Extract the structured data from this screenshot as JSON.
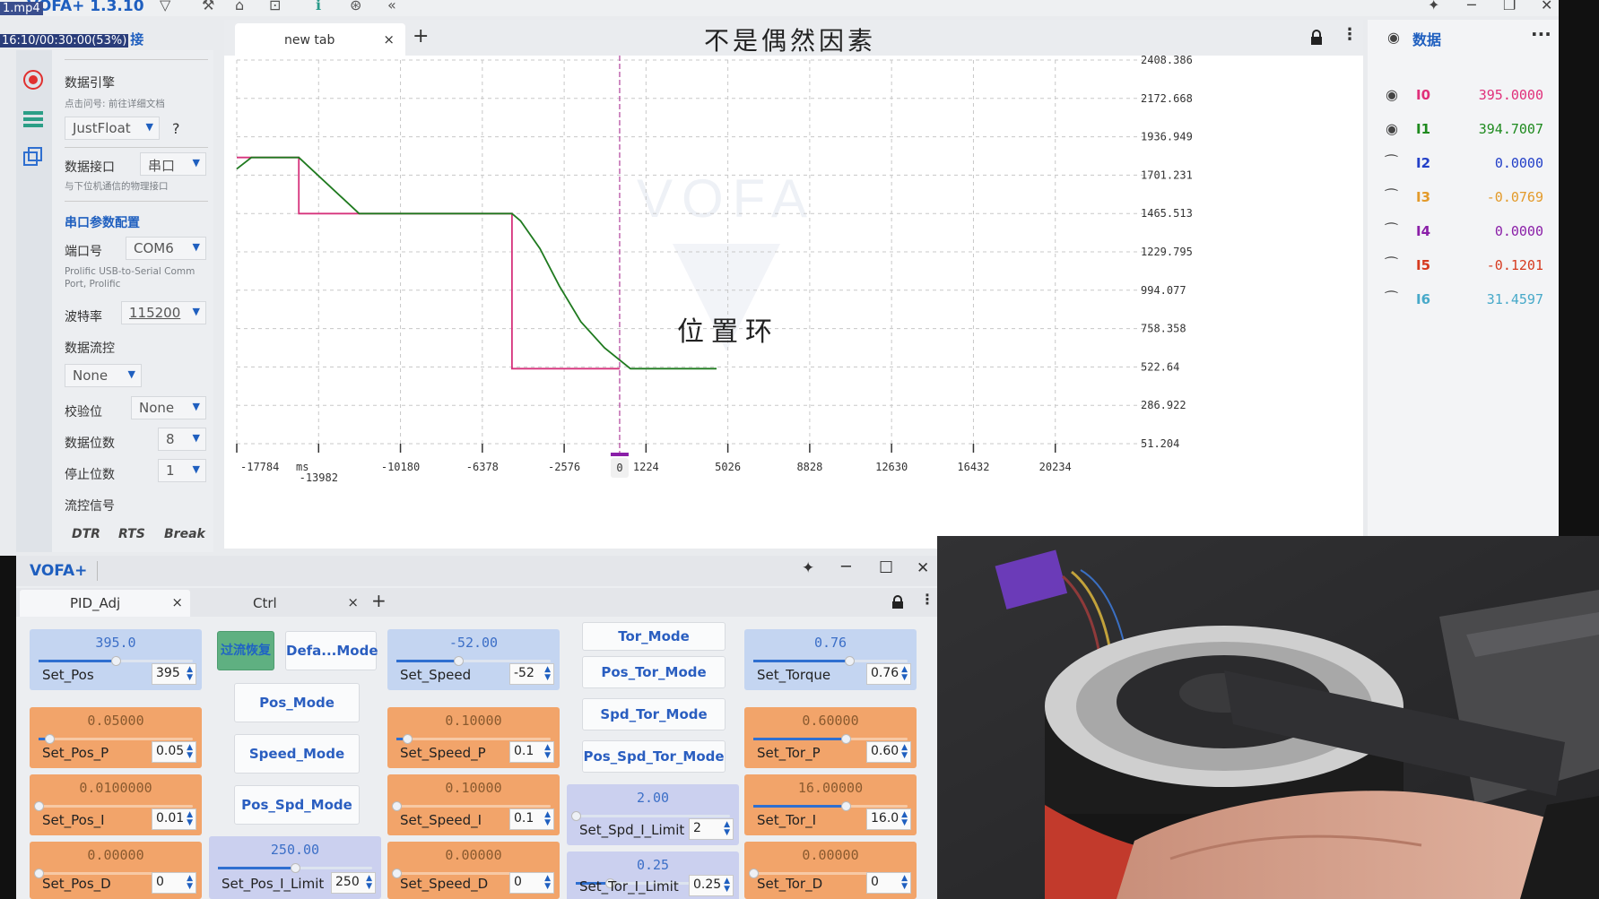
{
  "app": {
    "title": "VOFA+ 1.3.10",
    "video_file": "1.mp4",
    "video_time": "16:10/00:30:00(53%)",
    "connection_text": "接"
  },
  "settings": {
    "engine_label": "数据引擎",
    "engine_hint": "点击问号: 前往详细文档",
    "engine_value": "JustFloat",
    "help": "?",
    "interface_label": "数据接口",
    "interface_value": "串口",
    "interface_hint": "与下位机通信的物理接口",
    "serial_section": "串口参数配置",
    "port_label": "端口号",
    "port_value": "COM6",
    "port_desc": "Prolific USB-to-Serial Comm Port, Prolific",
    "baud_label": "波特率",
    "baud_value": "115200",
    "flow_label": "数据流控",
    "flow_value": "None",
    "parity_label": "校验位",
    "parity_value": "None",
    "databits_label": "数据位数",
    "databits_value": "8",
    "stopbits_label": "停止位数",
    "stopbits_value": "1",
    "signal_label": "流控信号",
    "dtr": "DTR",
    "rts": "RTS",
    "brk": "Break"
  },
  "plot": {
    "tab_label": "new tab",
    "tab_close": "×",
    "tab_add": "+",
    "title": "不是偶然因素",
    "overlay": "位置环",
    "watermark": "VOFA",
    "x_unit": "ms",
    "cursor_label": "0"
  },
  "chart_data": {
    "type": "line",
    "x_ticks_top": [
      "-17784",
      "-10180",
      "-6378",
      "-2576",
      "1224",
      "5026",
      "8828",
      "12630",
      "16432",
      "20234"
    ],
    "x_ticks_bottom": [
      "-13982"
    ],
    "y_ticks": [
      "2408.386",
      "2172.668",
      "1936.949",
      "1701.231",
      "1465.513",
      "1229.795",
      "994.077",
      "758.358",
      "522.64",
      "286.922",
      "51.204"
    ],
    "ylim": [
      51.204,
      2408.386
    ],
    "xlim": [
      -17784,
      24036
    ],
    "series": [
      {
        "color": "#d6337c",
        "points": [
          [
            -17784,
            1810
          ],
          [
            -14900,
            1810
          ],
          [
            -14900,
            1465
          ],
          [
            -5000,
            1465
          ],
          [
            -5000,
            512
          ],
          [
            0,
            512
          ]
        ]
      },
      {
        "color": "#1f7a1f",
        "points": [
          [
            -17784,
            1740
          ],
          [
            -17100,
            1810
          ],
          [
            -14900,
            1810
          ],
          [
            -12100,
            1465
          ],
          [
            -5000,
            1465
          ],
          [
            -4600,
            1420
          ],
          [
            -3700,
            1250
          ],
          [
            -2800,
            1020
          ],
          [
            -1800,
            800
          ],
          [
            -700,
            640
          ],
          [
            500,
            512
          ],
          [
            4500,
            512
          ]
        ]
      }
    ]
  },
  "data_panel": {
    "title": "数据",
    "more": "···",
    "channels": [
      {
        "name": "I0",
        "value": "395.0000",
        "color": "#e0307a",
        "visible": true
      },
      {
        "name": "I1",
        "value": "394.7007",
        "color": "#1e8a1e",
        "visible": true
      },
      {
        "name": "I2",
        "value": "0.0000",
        "color": "#2340c8",
        "visible": false
      },
      {
        "name": "I3",
        "value": "-0.0769",
        "color": "#e39a2a",
        "visible": false
      },
      {
        "name": "I4",
        "value": "0.0000",
        "color": "#8a1fa8",
        "visible": false
      },
      {
        "name": "I5",
        "value": "-0.1201",
        "color": "#d63a1f",
        "visible": false
      },
      {
        "name": "I6",
        "value": "31.4597",
        "color": "#47a9c9",
        "visible": false
      }
    ]
  },
  "bottom": {
    "title": "VOFA+",
    "tabs": [
      {
        "label": "PID_Adj",
        "close": "×"
      },
      {
        "label": "Ctrl",
        "close": "×"
      }
    ],
    "add": "+",
    "sliders": {
      "set_pos": {
        "display": "395.0",
        "name": "Set_Pos",
        "value": "395",
        "level": 0.5
      },
      "set_pos_p": {
        "display": "0.05000",
        "name": "Set_Pos_P",
        "value": "0.05",
        "level": 0.07
      },
      "set_pos_i": {
        "display": "0.0100000",
        "name": "Set_Pos_I",
        "value": "0.01",
        "level": 0.0
      },
      "set_pos_d": {
        "display": "0.00000",
        "name": "Set_Pos_D",
        "value": "0",
        "level": 0.0
      },
      "set_pos_i_limit": {
        "display": "250.00",
        "name": "Set_Pos_I_Limit",
        "value": "250",
        "level": 0.5
      },
      "set_speed": {
        "display": "-52.00",
        "name": "Set_Speed",
        "value": "-52",
        "level": 0.4
      },
      "set_speed_p": {
        "display": "0.10000",
        "name": "Set_Speed_P",
        "value": "0.1",
        "level": 0.07
      },
      "set_speed_i": {
        "display": "0.10000",
        "name": "Set_Speed_I",
        "value": "0.1",
        "level": 0.0
      },
      "set_speed_d": {
        "display": "0.00000",
        "name": "Set_Speed_D",
        "value": "0",
        "level": 0.0
      },
      "set_spd_i_limit": {
        "display": "2.00",
        "name": "Set_Spd_I_Limit",
        "value": "2",
        "level": 0.0
      },
      "set_tor_i_limit": {
        "display": "0.25",
        "name": "Set_Tor_I_Limit",
        "value": "0.25",
        "level": 0.22
      },
      "set_torque": {
        "display": "0.76",
        "name": "Set_Torque",
        "value": "0.76",
        "level": 0.62
      },
      "set_tor_p": {
        "display": "0.60000",
        "name": "Set_Tor_P",
        "value": "0.60",
        "level": 0.6
      },
      "set_tor_i": {
        "display": "16.00000",
        "name": "Set_Tor_I",
        "value": "16.0",
        "level": 0.6
      },
      "set_tor_d": {
        "display": "0.00000",
        "name": "Set_Tor_D",
        "value": "0",
        "level": 0.0
      }
    },
    "buttons": {
      "overcurrent": "过流恢复",
      "default_mode": "Defa...Mode",
      "pos_mode": "Pos_Mode",
      "speed_mode": "Speed_Mode",
      "pos_spd_mode": "Pos_Spd_Mode",
      "tor_mode": "Tor_Mode",
      "pos_tor_mode": "Pos_Tor_Mode",
      "spd_tor_mode": "Spd_Tor_Mode",
      "pos_spd_tor_mode": "Pos_Spd_Tor_Mode"
    }
  }
}
